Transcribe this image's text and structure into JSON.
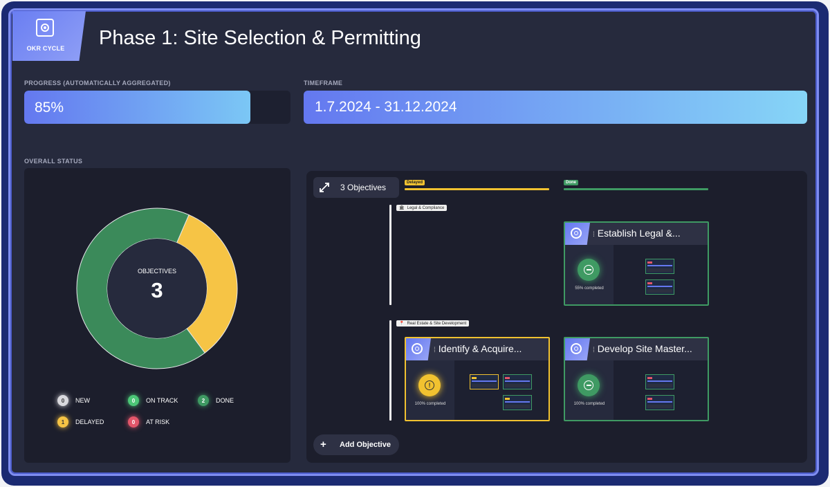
{
  "header": {
    "tab_label": "OKR CYCLE",
    "title": "Phase 1: Site Selection & Permitting"
  },
  "progress": {
    "label": "PROGRESS (AUTOMATICALLY AGGREGATED)",
    "value_text": "85%",
    "fraction": 0.85
  },
  "timeframe": {
    "label": "TIMEFRAME",
    "value": "1.7.2024 - 31.12.2024"
  },
  "overall_status": {
    "label": "OVERALL STATUS",
    "center_label": "OBJECTIVES",
    "count": "3",
    "segments": [
      {
        "name": "DELAYED",
        "value": 1,
        "color": "#f6c445"
      },
      {
        "name": "DONE",
        "value": 2,
        "color": "#3b8a5a"
      }
    ],
    "legend": [
      {
        "count": "0",
        "label": "NEW",
        "color": "#d9d9de"
      },
      {
        "count": "0",
        "label": "ON TRACK",
        "color": "#4cc777"
      },
      {
        "count": "2",
        "label": "DONE",
        "color": "#3f9a63"
      },
      {
        "count": "1",
        "label": "DELAYED",
        "color": "#f6c445"
      },
      {
        "count": "0",
        "label": "AT RISK",
        "color": "#e2566a"
      }
    ]
  },
  "map": {
    "objectives_button": "3 Objectives",
    "columns": [
      {
        "label": "Delayed",
        "color": "#f1c230"
      },
      {
        "label": "Done",
        "color": "#3f9a63"
      }
    ],
    "groups": [
      {
        "label": "Legal & Compliance",
        "icon": "building-icon"
      },
      {
        "label": "Real Estate & Site Development",
        "icon": "pin-icon"
      }
    ],
    "objectives": [
      {
        "title": "Establish Legal &...",
        "status": "done",
        "completed": "55% completed"
      },
      {
        "title": "Identify & Acquire...",
        "status": "delayed",
        "completed": "100% completed"
      },
      {
        "title": "Develop Site Master...",
        "status": "done",
        "completed": "100% completed"
      }
    ],
    "add_button": "Add Objective"
  }
}
